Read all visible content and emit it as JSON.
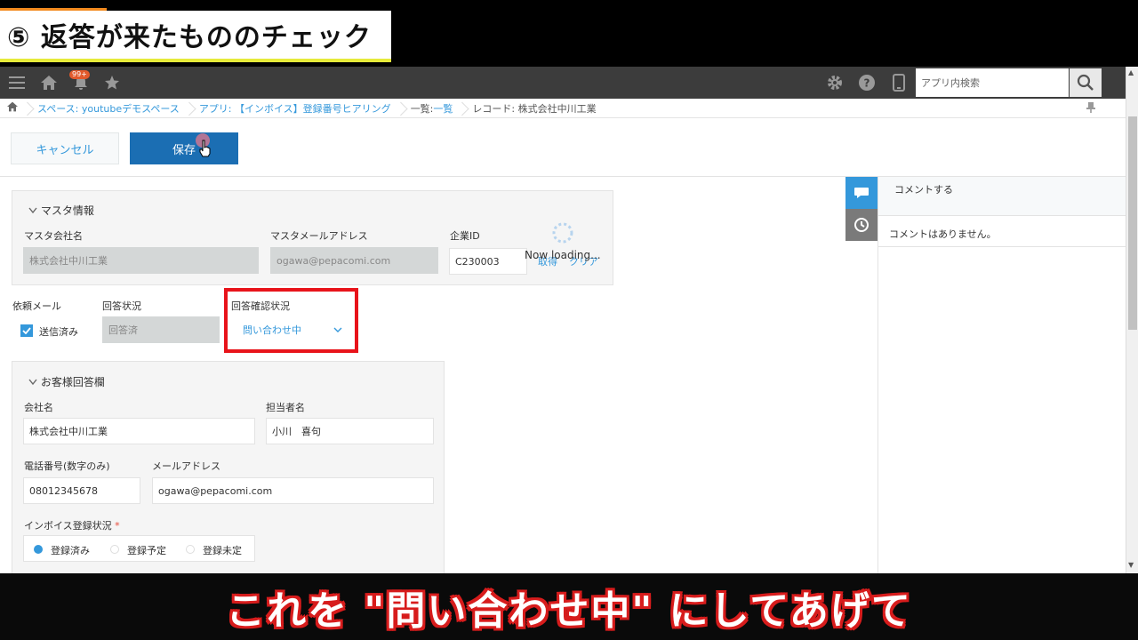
{
  "overlay": {
    "chapter_title": "⑤ 返答が来たもののチェック",
    "subtitle": "これを \"問い合わせ中\" にしてあげて"
  },
  "topbar": {
    "notif_badge": "99+",
    "search_placeholder": "アプリ内検索",
    "icons": [
      "menu-icon",
      "home-icon",
      "bell-icon",
      "star-icon",
      "gear-icon",
      "help-icon",
      "mobile-icon",
      "search-icon"
    ]
  },
  "breadcrumb": {
    "space": "スペース: youtubeデモスペース",
    "app": "アプリ: 【インボイス】登録番号ヒアリング",
    "list_prefix": "一覧: ",
    "list_link": "一覧",
    "record": "レコード: 株式会社中川工業"
  },
  "actions": {
    "cancel": "キャンセル",
    "save": "保存"
  },
  "master": {
    "title": "マスタ情報",
    "company_label": "マスタ会社名",
    "company_value": "株式会社中川工業",
    "email_label": "マスタメールアドレス",
    "email_value": "ogawa@pepacomi.com",
    "id_label": "企業ID",
    "id_value": "C230003",
    "get_link": "取得",
    "clear_link": "クリア",
    "loading": "Now loading..."
  },
  "status": {
    "request_label": "依頼メール",
    "request_checkbox": "送信済み",
    "answer_label": "回答状況",
    "answer_value": "回答済",
    "confirm_label": "回答確認状況",
    "confirm_value": "問い合わせ中"
  },
  "customer": {
    "title": "お客様回答欄",
    "company_label": "会社名",
    "company_value": "株式会社中川工業",
    "person_label": "担当者名",
    "person_value": "小川　喜句",
    "phone_label": "電話番号(数字のみ)",
    "phone_value": "08012345678",
    "mail_label": "メールアドレス",
    "mail_value": "ogawa@pepacomi.com",
    "invoice_label": "インボイス登録状況",
    "required_mark": "*",
    "radio_options": [
      "登録済み",
      "登録予定",
      "登録未定"
    ],
    "radio_selected": "登録済み"
  },
  "comments": {
    "input_placeholder": "コメントする",
    "empty": "コメントはありません。"
  },
  "colors": {
    "accent": "#1b6eb3",
    "link": "#3498db",
    "highlight": "#e8131a",
    "topbar": "#3c3c3c"
  }
}
